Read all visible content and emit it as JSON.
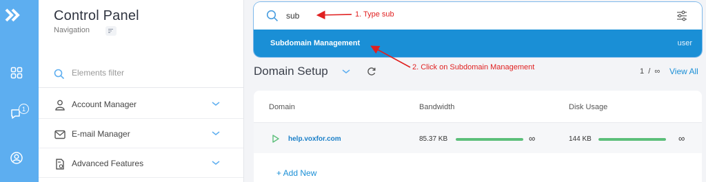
{
  "nav": {
    "title": "Control Panel",
    "subtitle": "Navigation",
    "filter_placeholder": "Elements filter",
    "items": [
      {
        "label": "Account Manager",
        "icon": "user-icon"
      },
      {
        "label": "E-mail Manager",
        "icon": "mail-icon"
      },
      {
        "label": "Advanced Features",
        "icon": "settings-doc-icon"
      }
    ]
  },
  "rail": {
    "notification_count": "1",
    "icons": [
      "logo-icon",
      "grid-icon",
      "chat-icon",
      "profile-icon"
    ]
  },
  "search": {
    "query": "sub",
    "result": {
      "match": "Sub",
      "rest": "domain Management",
      "scope": "user"
    }
  },
  "annotations": {
    "step1": "1. Type sub",
    "step2": "2. Click on Subdomain Management"
  },
  "section": {
    "title": "Domain Setup",
    "page_current": "1",
    "page_sep": "/",
    "page_total": "∞",
    "view_all": "View All"
  },
  "table": {
    "headers": [
      "Domain",
      "Bandwidth",
      "Disk Usage"
    ],
    "rows": [
      {
        "domain": "help.voxfor.com",
        "bandwidth": "85.37 KB",
        "bandwidth_limit": "∞",
        "bandwidth_fill": 1.0,
        "disk": "144 KB",
        "disk_limit": "∞",
        "disk_fill": 1.0
      }
    ],
    "add_new": "+ Add New"
  },
  "colors": {
    "accent": "#1a8fd6",
    "rail": "#5daef0",
    "annotation": "#e02020",
    "usage_bar": "#5cbf7a"
  }
}
